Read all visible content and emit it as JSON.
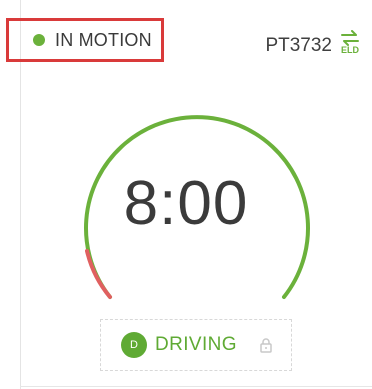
{
  "status": {
    "label": "IN MOTION",
    "dot_color": "#6bb13b",
    "highlight_color": "#d93a3a"
  },
  "vehicle": {
    "id": "PT3732"
  },
  "eld": {
    "label": "ELD",
    "icon": "swap-arrows-icon"
  },
  "timer": {
    "value": "8:00",
    "arc_color": "#6bb13b",
    "warning_color": "#e06060"
  },
  "duty": {
    "badge": "D",
    "label": "DRIVING",
    "color": "#5faa34",
    "lock_icon": "lock-icon"
  }
}
